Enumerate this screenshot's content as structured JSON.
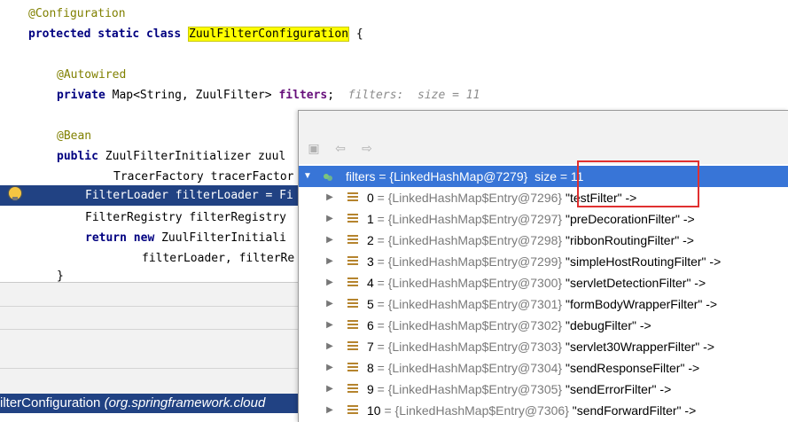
{
  "editor": {
    "line1": {
      "annotation": "@Configuration"
    },
    "line2": {
      "kw": "protected static class",
      "class_name": "ZuulFilterConfiguration",
      "rest": " {"
    },
    "line4": {
      "annotation": "@Autowired"
    },
    "line5": {
      "kw": "private",
      "type": " Map<String, ZuulFilter> ",
      "field": "filters",
      "semi": ";",
      "hint": "filters:  size = 11"
    },
    "line7": {
      "annotation": "@Bean"
    },
    "line8": {
      "kw": "public",
      "text": " ZuulFilterInitializer zuul"
    },
    "line9": {
      "text": "TracerFactory tracerFactor"
    },
    "line10": {
      "text": "FilterLoader filterLoader = Fi"
    },
    "line11": {
      "text": "FilterRegistry filterRegistry "
    },
    "line12": {
      "kw1": "return",
      "kw2": "new",
      "text": " ZuulFilterInitiali"
    },
    "line13": {
      "text": "filterLoader, filterRe"
    },
    "line14": {
      "text": "}"
    }
  },
  "bottom": {
    "selected_class": "ilterConfiguration",
    "selected_pkg": " (org.springframework.cloud"
  },
  "popup": {
    "root": {
      "label": "filters = {LinkedHashMap@7279}",
      "size": "size = 11"
    },
    "entries": [
      {
        "idx": "0",
        "ref": " = {LinkedHashMap$Entry@7296}",
        "key": " \"testFilter\"",
        "arrow": " ->"
      },
      {
        "idx": "1",
        "ref": " = {LinkedHashMap$Entry@7297}",
        "key": " \"preDecorationFilter\"",
        "arrow": " ->"
      },
      {
        "idx": "2",
        "ref": " = {LinkedHashMap$Entry@7298}",
        "key": " \"ribbonRoutingFilter\"",
        "arrow": " ->"
      },
      {
        "idx": "3",
        "ref": " = {LinkedHashMap$Entry@7299}",
        "key": " \"simpleHostRoutingFilter\"",
        "arrow": " ->"
      },
      {
        "idx": "4",
        "ref": " = {LinkedHashMap$Entry@7300}",
        "key": " \"servletDetectionFilter\"",
        "arrow": " ->"
      },
      {
        "idx": "5",
        "ref": " = {LinkedHashMap$Entry@7301}",
        "key": " \"formBodyWrapperFilter\"",
        "arrow": " ->"
      },
      {
        "idx": "6",
        "ref": " = {LinkedHashMap$Entry@7302}",
        "key": " \"debugFilter\"",
        "arrow": " ->"
      },
      {
        "idx": "7",
        "ref": " = {LinkedHashMap$Entry@7303}",
        "key": " \"servlet30WrapperFilter\"",
        "arrow": " ->"
      },
      {
        "idx": "8",
        "ref": " = {LinkedHashMap$Entry@7304}",
        "key": " \"sendResponseFilter\"",
        "arrow": " ->"
      },
      {
        "idx": "9",
        "ref": " = {LinkedHashMap$Entry@7305}",
        "key": " \"sendErrorFilter\"",
        "arrow": " ->"
      },
      {
        "idx": "10",
        "ref": " = {LinkedHashMap$Entry@7306}",
        "key": " \"sendForwardFilter\"",
        "arrow": " ->"
      }
    ],
    "icons": [
      "folder-icon",
      "back-arrow-icon",
      "forward-arrow-icon"
    ]
  },
  "colors": {
    "selection": "#3875d7",
    "editor_highlight": "#214283",
    "annotation_box": "#e03030"
  }
}
